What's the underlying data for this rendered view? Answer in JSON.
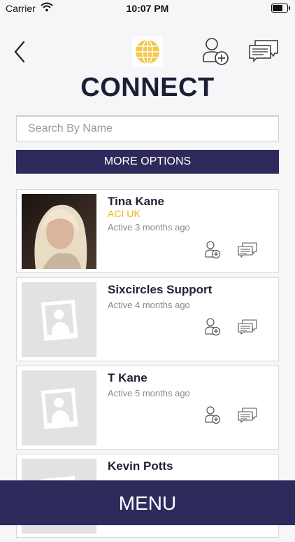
{
  "status_bar": {
    "carrier": "Carrier",
    "time": "10:07 PM",
    "battery_level": 0.8
  },
  "header": {
    "title": "CONNECT"
  },
  "search": {
    "placeholder": "Search By Name",
    "value": ""
  },
  "more_options_label": "MORE OPTIONS",
  "contacts": [
    {
      "name": "Tina Kane",
      "org": "ACI UK",
      "active": "Active 3 months ago",
      "has_photo": true
    },
    {
      "name": "Sixcircles Support",
      "org": "",
      "active": "Active 4 months ago",
      "has_photo": false
    },
    {
      "name": "T Kane",
      "org": "",
      "active": "Active 5 months ago",
      "has_photo": false
    },
    {
      "name": "Kevin Potts",
      "org": "",
      "active": "",
      "has_photo": false
    }
  ],
  "menu_label": "MENU",
  "icons": {
    "back": "chevron-left-icon",
    "logo": "globe-logo",
    "add_contact": "add-user-icon",
    "messages": "chat-bubbles-icon"
  },
  "colors": {
    "accent": "#2e2a5c",
    "org_text": "#e8b820",
    "logo": "#f2c94c"
  }
}
